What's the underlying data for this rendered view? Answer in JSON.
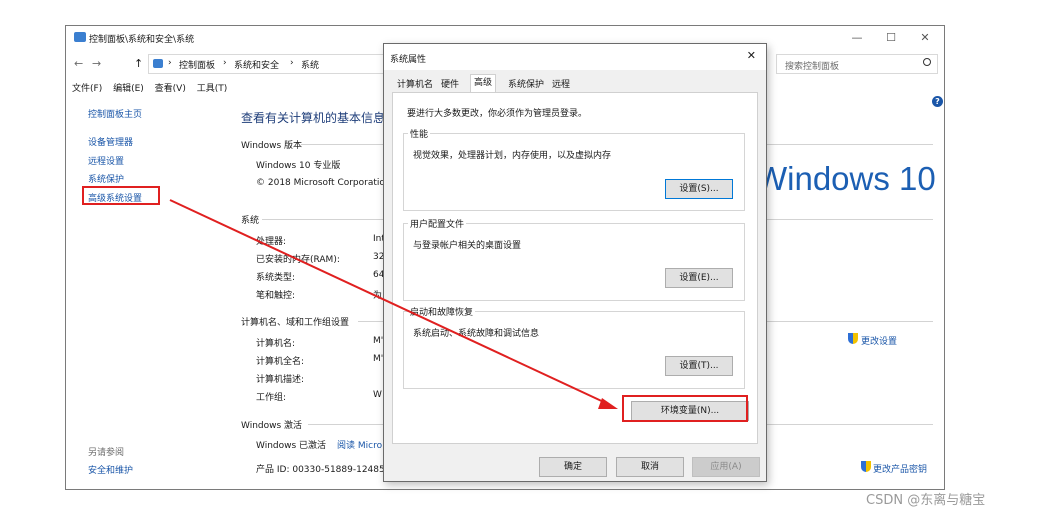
{
  "main": {
    "title": "控制面板\\系统和安全\\系统",
    "min": "—",
    "max": "☐",
    "close": "✕",
    "nav_back": "←",
    "nav_forward": "→",
    "nav_up": "↑",
    "breadcrumb": [
      "控制面板",
      "系统和安全",
      "系统"
    ],
    "breadcrumb_sep": "›",
    "search_placeholder": "搜索控制面板",
    "menu": [
      "文件(F)",
      "编辑(E)",
      "查看(V)",
      "工具(T)"
    ],
    "sidebar": {
      "home": "控制面板主页",
      "items": [
        "设备管理器",
        "远程设置",
        "系统保护",
        "高级系统设置"
      ],
      "see_also": "另请参阅",
      "security": "安全和维护"
    },
    "content": {
      "heading": "查看有关计算机的基本信息",
      "edition_label": "Windows 版本",
      "edition_name": "Windows 10 专业版",
      "copyright": "© 2018 Microsoft Corporation",
      "logo_text": "Windows 10",
      "system_label": "系统",
      "system_rows": [
        {
          "label": "处理器:",
          "value": "Int"
        },
        {
          "label": "已安装的内存(RAM):",
          "value": "32"
        },
        {
          "label": "系统类型:",
          "value": "64"
        },
        {
          "label": "笔和触控:",
          "value": "为"
        }
      ],
      "computer_label": "计算机名、域和工作组设置",
      "computer_rows": [
        {
          "label": "计算机名:",
          "value": "M'"
        },
        {
          "label": "计算机全名:",
          "value": "M'"
        },
        {
          "label": "计算机描述:",
          "value": ""
        },
        {
          "label": "工作组:",
          "value": "W"
        }
      ],
      "change_settings": "更改设置",
      "activation_label": "Windows 激活",
      "activated": "Windows 已激活",
      "read_link": "阅读 Micro",
      "product_id": "产品 ID: 00330-51889-12485",
      "change_key": "更改产品密钥"
    }
  },
  "dialog": {
    "title": "系统属性",
    "close": "✕",
    "tabs": [
      "计算机名",
      "硬件",
      "高级",
      "系统保护",
      "远程"
    ],
    "active_tab": "高级",
    "admin_note": "要进行大多数更改，你必须作为管理员登录。",
    "performance": {
      "label": "性能",
      "desc": "视觉效果，处理器计划，内存使用，以及虚拟内存",
      "button": "设置(S)..."
    },
    "profiles": {
      "label": "用户配置文件",
      "desc": "与登录帐户相关的桌面设置",
      "button": "设置(E)..."
    },
    "startup": {
      "label": "启动和故障恢复",
      "desc": "系统启动、系统故障和调试信息",
      "button": "设置(T)..."
    },
    "env_button": "环境变量(N)...",
    "ok": "确定",
    "cancel": "取消",
    "apply": "应用(A)"
  },
  "watermark": "CSDN @东离与糖宝",
  "colors": {
    "accent": "#0078d7",
    "link": "#1a56a8",
    "highlight": "#e02020",
    "logo": "#1c5fb3"
  }
}
